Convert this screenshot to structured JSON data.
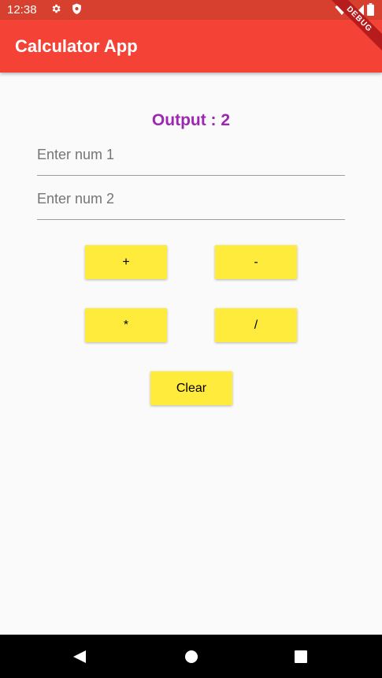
{
  "status_bar": {
    "time": "12:38",
    "icons": [
      "gear-icon",
      "shield-icon",
      "wifi-icon",
      "signal-icon",
      "battery-icon"
    ],
    "color": "#d7402f"
  },
  "app_bar": {
    "title": "Calculator App",
    "color": "#f44336"
  },
  "debug_banner": {
    "label": "DEBUG"
  },
  "output": {
    "label": "Output : 2",
    "color": "#9c27b0"
  },
  "inputs": {
    "num1": {
      "value": "",
      "placeholder": "Enter num 1"
    },
    "num2": {
      "value": "",
      "placeholder": "Enter num 2"
    }
  },
  "buttons": {
    "add": "+",
    "subtract": "-",
    "multiply": "*",
    "divide": "/",
    "clear": "Clear",
    "color": "#ffeb3b"
  },
  "nav_bar": {
    "icons": [
      "back-icon",
      "home-icon",
      "recents-icon"
    ]
  }
}
